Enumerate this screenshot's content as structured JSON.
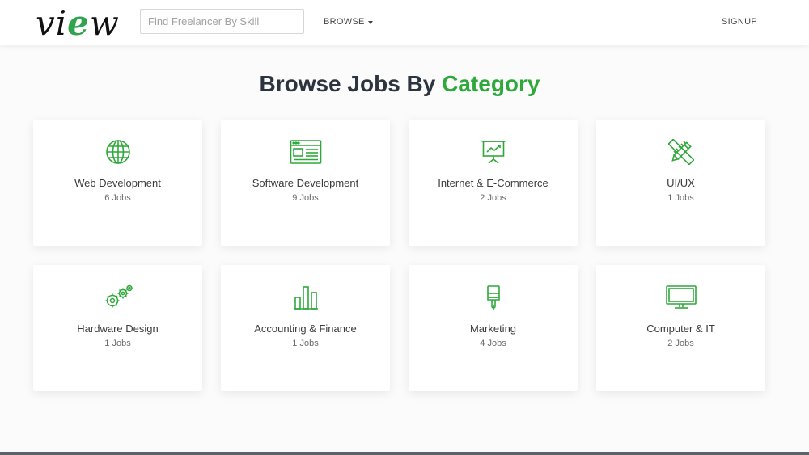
{
  "header": {
    "logo": {
      "text_before": "vi",
      "text_accent": "e",
      "text_after": "w"
    },
    "search": {
      "placeholder": "Find Freelancer By Skill",
      "value": ""
    },
    "browse_label": "BROWSE",
    "signup_label": "SIGNUP"
  },
  "main": {
    "heading_prefix": "Browse Jobs By",
    "heading_highlight": "Category",
    "categories": [
      {
        "title": "Web Development",
        "count": "6 Jobs",
        "icon": "globe-icon"
      },
      {
        "title": "Software Development",
        "count": "9 Jobs",
        "icon": "browser-window-icon"
      },
      {
        "title": "Internet & E-Commerce",
        "count": "2 Jobs",
        "icon": "presentation-chart-icon"
      },
      {
        "title": "UI/UX",
        "count": "1 Jobs",
        "icon": "pencil-ruler-icon"
      },
      {
        "title": "Hardware Design",
        "count": "1 Jobs",
        "icon": "gears-icon"
      },
      {
        "title": "Accounting & Finance",
        "count": "1 Jobs",
        "icon": "bar-chart-icon"
      },
      {
        "title": "Marketing",
        "count": "4 Jobs",
        "icon": "paint-brush-icon"
      },
      {
        "title": "Computer & IT",
        "count": "2 Jobs",
        "icon": "monitor-icon"
      }
    ]
  },
  "colors": {
    "accent_green": "#2ea83a",
    "heading_dark": "#2c3440",
    "footer_bar": "#5c636b"
  }
}
